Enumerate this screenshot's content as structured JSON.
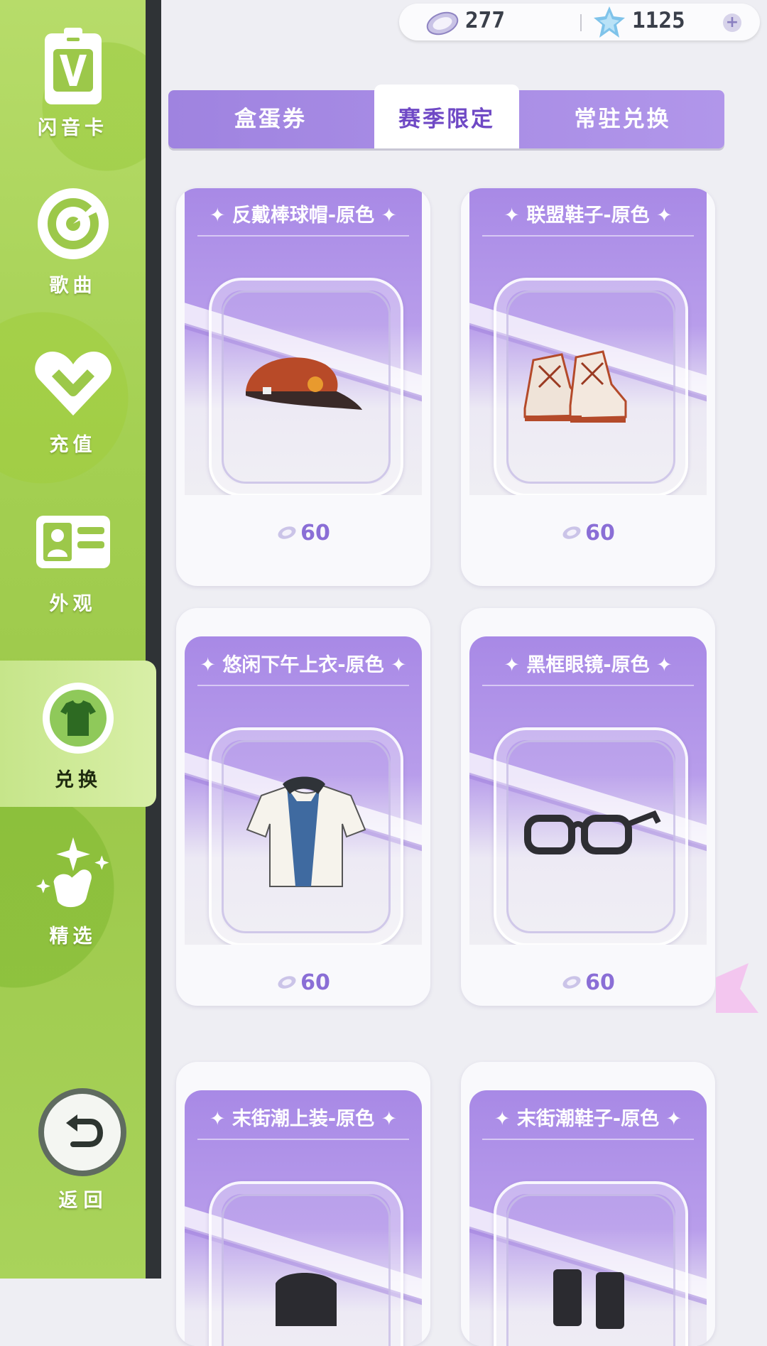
{
  "sidebar": {
    "items": [
      {
        "label": "闪音卡",
        "icon": "v-card-icon"
      },
      {
        "label": "歌曲",
        "icon": "disc-icon"
      },
      {
        "label": "充值",
        "icon": "heart-icon"
      },
      {
        "label": "外观",
        "icon": "id-card-icon"
      },
      {
        "label": "兑换",
        "icon": "shirt-icon",
        "active": true
      },
      {
        "label": "精选",
        "icon": "sparkle-hand-icon"
      }
    ],
    "back_label": "返回"
  },
  "currency": {
    "ticket_amount": "277",
    "crystal_amount": "1125",
    "add_symbol": "+"
  },
  "tabs": [
    {
      "label": "盒蛋券"
    },
    {
      "label": "赛季限定",
      "active": true
    },
    {
      "label": "常驻兑换"
    }
  ],
  "items": [
    {
      "name": "反戴棒球帽-原色",
      "price": "60",
      "art": "cap"
    },
    {
      "name": "联盟鞋子-原色",
      "price": "60",
      "art": "sneakers"
    },
    {
      "name": "悠闲下午上衣-原色",
      "price": "60",
      "art": "shirt"
    },
    {
      "name": "黑框眼镜-原色",
      "price": "60",
      "art": "glasses"
    },
    {
      "name": "末街潮上装-原色",
      "price": "",
      "art": "jacket"
    },
    {
      "name": "末街潮鞋子-原色",
      "price": "",
      "art": "boots"
    }
  ],
  "colors": {
    "accent_purple": "#9f83e0",
    "sidebar_green": "#a4d052",
    "price_purple": "#8a6ed6"
  }
}
